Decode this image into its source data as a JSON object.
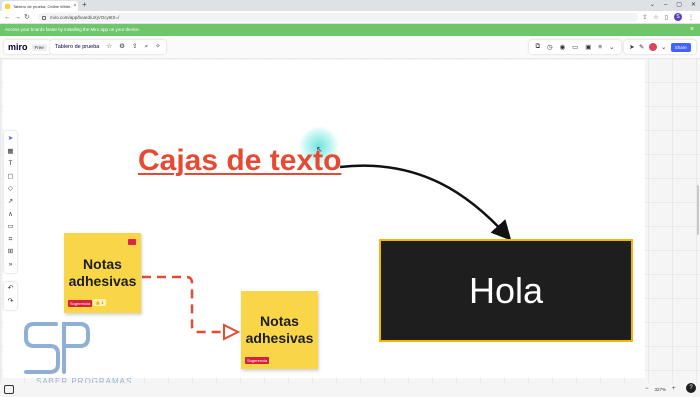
{
  "browser": {
    "tab_title": "Tablero de prueba, Online White...",
    "tab_close": "×",
    "new_tab": "+",
    "window_controls": [
      "⌄",
      "–",
      "▢",
      "✕"
    ],
    "url": "miro.com/app/board/uXjVOcy6tX=/",
    "profile_initial": "S"
  },
  "banner": {
    "text": "Access your boards faster by installing the Miro app on your device.",
    "close": "×"
  },
  "header": {
    "logo": "miro",
    "plan_badge": "Free",
    "board_name": "Tablero de prueba",
    "share_label": "Share"
  },
  "canvas": {
    "heading": "Cajas de texto",
    "sticky1_text": "Notas adhesivas",
    "sticky1_tag": "Sugerencia",
    "sticky1_reaction": "👍 1",
    "sticky2_text": "Notas adhesivas",
    "sticky2_tag": "Sugerencia",
    "shape_text": "Hola"
  },
  "colors": {
    "heading": "#e64a33",
    "sticky": "#f9d648",
    "shape_fill": "#1e1e1e",
    "shape_border": "#f2b500",
    "banner": "#6fc66a",
    "share_button": "#4262ff"
  },
  "watermark": {
    "text": "SABER PROGRAMAS"
  },
  "footer": {
    "zoom": "327%",
    "zoom_out": "−",
    "zoom_in": "+",
    "help": "?"
  }
}
